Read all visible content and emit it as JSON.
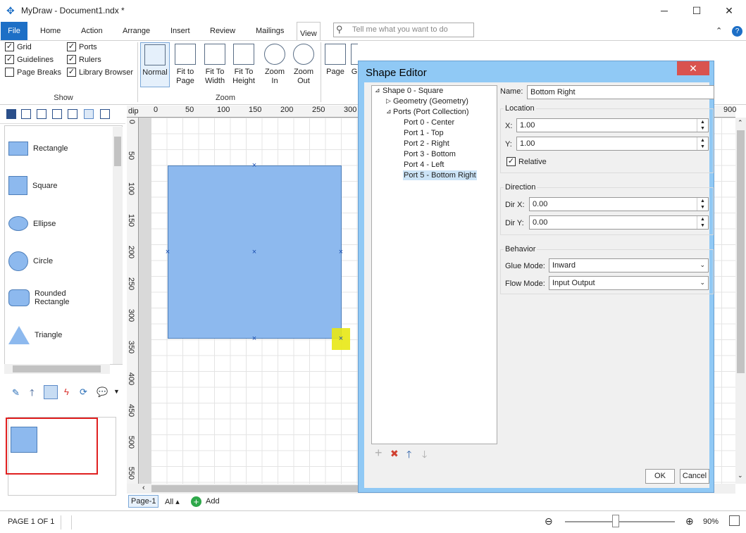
{
  "app": {
    "title": "MyDraw - Document1.ndx *",
    "minimize": "─",
    "maximize": "☐",
    "close": "✕"
  },
  "tabs": [
    "File",
    "Home",
    "Action",
    "Arrange",
    "Insert",
    "Review",
    "Mailings",
    "View"
  ],
  "tell_me": "Tell me what you want to do",
  "ribbon": {
    "show": {
      "label": "Show",
      "items": [
        {
          "label": "Grid",
          "checked": true
        },
        {
          "label": "Guidelines",
          "checked": true
        },
        {
          "label": "Page Breaks",
          "checked": false
        },
        {
          "label": "Ports",
          "checked": true
        },
        {
          "label": "Rulers",
          "checked": true
        },
        {
          "label": "Library Browser",
          "checked": true
        }
      ]
    },
    "zoom": {
      "label": "Zoom",
      "buttons": [
        "Normal",
        "Fit to Page",
        "Fit To Width",
        "Fit To Height",
        "Zoom In",
        "Zoom Out"
      ]
    },
    "more": [
      "Page",
      "G"
    ]
  },
  "shapes": [
    "Rectangle",
    "Square",
    "Ellipse",
    "Circle",
    "Rounded Rectangle",
    "Triangle"
  ],
  "ruler": {
    "unit": "dip",
    "h": [
      "0",
      "50",
      "100",
      "150",
      "200",
      "250",
      "300",
      "900"
    ],
    "v": [
      "0",
      "50",
      "100",
      "150",
      "200",
      "250",
      "300",
      "350",
      "400",
      "450",
      "500",
      "550"
    ]
  },
  "page_tabs": {
    "page": "Page-1",
    "all": "All ▴",
    "add": "Add"
  },
  "status": {
    "page": "PAGE 1 OF 1",
    "zoom": "90%",
    "zoom_fraction": 0.46
  },
  "dialog": {
    "title": "Shape Editor",
    "tree": [
      {
        "label": "Shape 0 - Square",
        "level": 0,
        "expand": "⊿"
      },
      {
        "label": "Geometry (Geometry)",
        "level": 1,
        "expand": "▷"
      },
      {
        "label": "Ports (Port Collection)",
        "level": 1,
        "expand": "⊿"
      },
      {
        "label": "Port 0 - Center",
        "level": 2
      },
      {
        "label": "Port 1 - Top",
        "level": 2
      },
      {
        "label": "Port 2 - Right",
        "level": 2
      },
      {
        "label": "Port 3 - Bottom",
        "level": 2
      },
      {
        "label": "Port 4 - Left",
        "level": 2
      },
      {
        "label": "Port 5 - Bottom Right",
        "level": 2,
        "selected": true
      }
    ],
    "name_label": "Name:",
    "name": "Bottom Right",
    "location": {
      "label": "Location",
      "x_label": "X:",
      "x": "1.00",
      "y_label": "Y:",
      "y": "1.00",
      "relative_label": "Relative",
      "relative": true
    },
    "direction": {
      "label": "Direction",
      "dx_label": "Dir X:",
      "dx": "0.00",
      "dy_label": "Dir Y:",
      "dy": "0.00"
    },
    "behavior": {
      "label": "Behavior",
      "glue_label": "Glue Mode:",
      "glue": "Inward",
      "flow_label": "Flow Mode:",
      "flow": "Input Output"
    },
    "ok": "OK",
    "cancel": "Cancel",
    "tree_tools": {
      "add": "+",
      "delete": "✖",
      "up": "🡑",
      "down": "🡓"
    }
  },
  "colors": {
    "accent": "#1d6fc6",
    "shape_fill": "#8db9ee",
    "dialog_border": "#90c9f5",
    "close_red": "#d9534f"
  }
}
